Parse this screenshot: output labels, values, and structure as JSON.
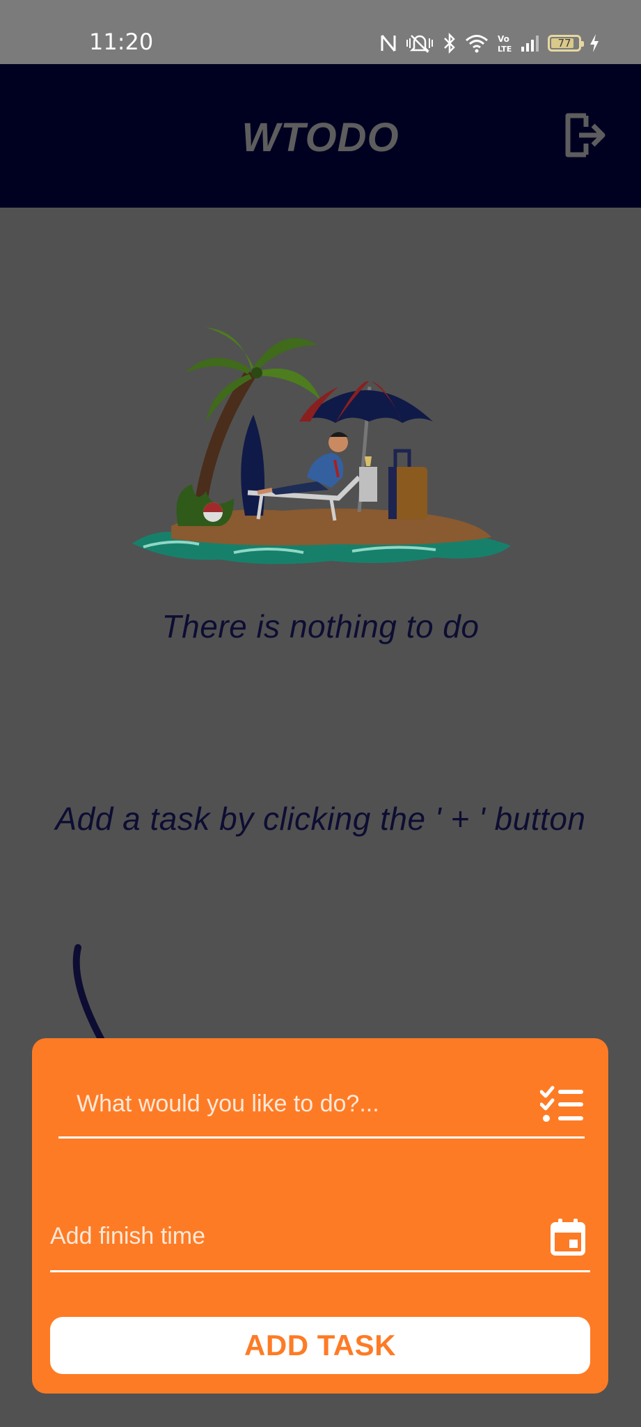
{
  "status_bar": {
    "time": "11:20",
    "battery_level": "77",
    "icons": [
      "nfc-icon",
      "vibrate-icon",
      "bluetooth-icon",
      "wifi-icon",
      "volte-icon",
      "signal-icon",
      "battery-icon",
      "charging-icon"
    ]
  },
  "app_bar": {
    "title": "WTODO",
    "logout_icon": "logout-icon",
    "bg_color": "#000021"
  },
  "empty_state": {
    "illustration": "beach-island-illustration",
    "title": "There is nothing to do",
    "hint": "Add a task by clicking the ' + ' button"
  },
  "add_task_sheet": {
    "task_placeholder": "What would you like to do?...",
    "task_icon": "checklist-icon",
    "time_placeholder": "Add finish time",
    "time_icon": "calendar-icon",
    "submit_label": "ADD TASK",
    "accent_color": "#fe7b25"
  }
}
